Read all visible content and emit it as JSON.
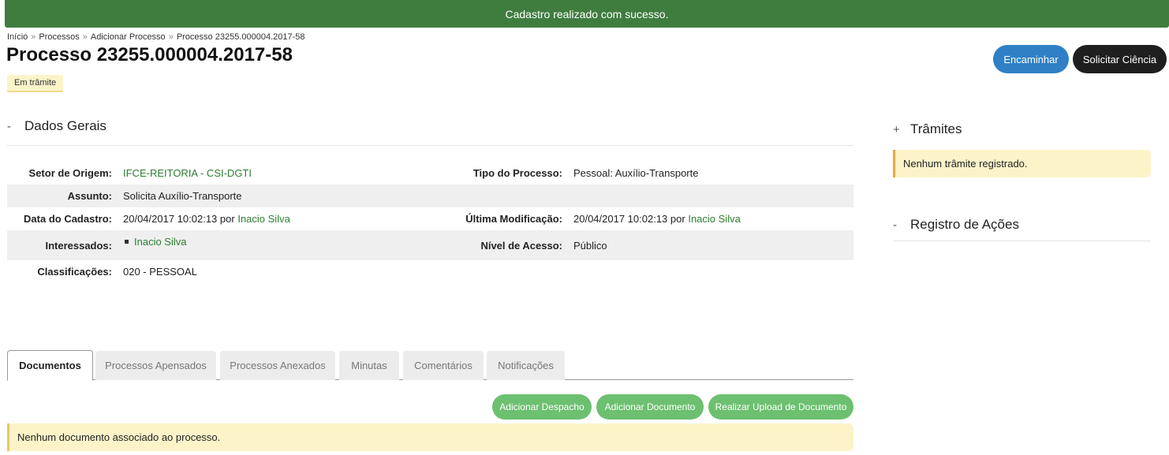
{
  "flash": {
    "message": "Cadastro realizado com sucesso."
  },
  "breadcrumb": [
    {
      "label": "Início"
    },
    {
      "label": "Processos"
    },
    {
      "label": "Adicionar Processo"
    },
    {
      "label": "Processo 23255.000004.2017-58"
    }
  ],
  "breadcrumb_sep": "»",
  "header": {
    "title": "Processo 23255.000004.2017-58",
    "status": "Em trâmite",
    "buttons": {
      "encaminhar": "Encaminhar",
      "solicitar_ciencia": "Solicitar Ciência"
    }
  },
  "dados_gerais": {
    "toggle": "-",
    "title": "Dados Gerais",
    "setor_origem": {
      "label": "Setor de Origem:",
      "value": "IFCE-REITORIA - CSI-DGTI"
    },
    "tipo_processo": {
      "label": "Tipo do Processo:",
      "value": "Pessoal: Auxílio-Transporte"
    },
    "assunto": {
      "label": "Assunto:",
      "value": "Solicita Auxílio-Transporte"
    },
    "data_cadastro": {
      "label": "Data do Cadastro:",
      "date": "20/04/2017 10:02:13",
      "por": "por",
      "user": "Inacio Silva"
    },
    "ultima_modificacao": {
      "label": "Última Modificação:",
      "date": "20/04/2017 10:02:13",
      "por": "por",
      "user": "Inacio Silva"
    },
    "interessados": {
      "label": "Interessados:",
      "value": "Inacio Silva"
    },
    "nivel_acesso": {
      "label": "Nível de Acesso:",
      "value": "Público"
    },
    "classificacoes": {
      "label": "Classificações:",
      "value": "020 - PESSOAL"
    }
  },
  "tramites": {
    "toggle": "+",
    "title": "Trâmites",
    "empty_message": "Nenhum trâmite registrado."
  },
  "registro_acoes": {
    "toggle": "-",
    "title": "Registro de Ações"
  },
  "tabs": [
    {
      "label": "Documentos",
      "active": true
    },
    {
      "label": "Processos Apensados",
      "active": false
    },
    {
      "label": "Processos Anexados",
      "active": false
    },
    {
      "label": "Minutas",
      "active": false
    },
    {
      "label": "Comentários",
      "active": false
    },
    {
      "label": "Notificações",
      "active": false
    }
  ],
  "documentos": {
    "buttons": {
      "adicionar_despacho": "Adicionar Despacho",
      "adicionar_documento": "Adicionar Documento",
      "realizar_upload": "Realizar Upload de Documento"
    },
    "empty_message": "Nenhum documento associado ao processo."
  },
  "colors": {
    "flash_bg": "#3f7d3f",
    "primary_button": "#2f80c6",
    "dark_button": "#1f1f1f",
    "green_button": "#6cc070",
    "link": "#2e7d32",
    "warning_bg": "#fcf3c9"
  }
}
